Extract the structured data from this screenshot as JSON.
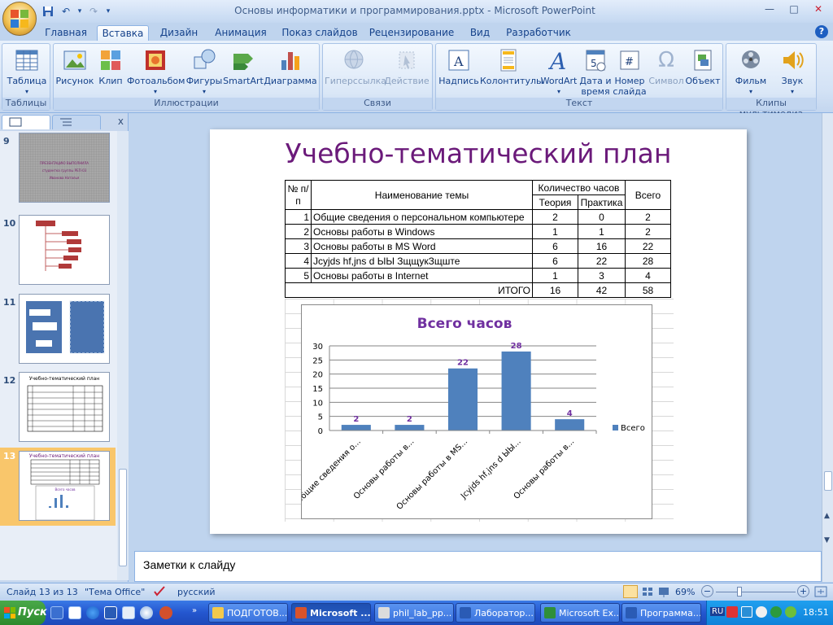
{
  "window": {
    "title": "Основы информатики и программирования.pptx - Microsoft PowerPoint",
    "minimize": "—",
    "maximize": "□",
    "close": "✕"
  },
  "qat": {
    "save": "💾",
    "undo": "↶",
    "redo": "↷",
    "customize": "▾"
  },
  "tabs": [
    "Главная",
    "Вставка",
    "Дизайн",
    "Анимация",
    "Показ слайдов",
    "Рецензирование",
    "Вид",
    "Разработчик"
  ],
  "active_tab": "Вставка",
  "help": "?",
  "ribbon": {
    "groups": {
      "tables": "Таблицы",
      "illustrations": "Иллюстрации",
      "links": "Связи",
      "text": "Текст",
      "media": "Клипы мультимедиа"
    },
    "buttons": {
      "table": "Таблица",
      "picture": "Рисунок",
      "clip": "Клип",
      "photoalbum": "Фотоальбом",
      "shapes": "Фигуры",
      "smartart": "SmartArt",
      "chart": "Диаграмма",
      "hyperlink": "Гиперссылка",
      "action": "Действие",
      "textbox": "Надпись",
      "header_footer": "Колонтитулы",
      "wordart": "WordArt",
      "datetime_1": "Дата и",
      "datetime_2": "время",
      "slidenum_1": "Номер",
      "slidenum_2": "слайда",
      "symbol": "Символ",
      "object": "Объект",
      "movie": "Фильм",
      "sound": "Звук"
    },
    "colors": {
      "chart_bar_blue": "#4f81bd",
      "chart_bar_red": "#c0504d",
      "chart_bar_green": "#9bbb59"
    }
  },
  "slides_panel": {
    "close": "x",
    "items": [
      {
        "num": "9",
        "lines": [
          "ПРЕЗЕНТАЦИЮ ВЫПОЛНИЛА",
          "студентка группы РЕП-03",
          "Иванова Наталья"
        ]
      },
      {
        "num": "10"
      },
      {
        "num": "11"
      },
      {
        "num": "12",
        "title": "Учебно-тематический план"
      },
      {
        "num": "13",
        "title": "Учебно-тематический план",
        "chart_title": "Всего часов"
      }
    ]
  },
  "slide": {
    "title": "Учебно-тематический план",
    "table": {
      "h_num": "№ п/п",
      "h_name": "Наименование темы",
      "h_hours": "Количество часов",
      "h_theory": "Теория",
      "h_practice": "Практика",
      "h_total": "Всего",
      "rows": [
        {
          "n": "1",
          "name": "Общие сведения о персональном компьютере",
          "theory": "2",
          "practice": "0",
          "total": "2"
        },
        {
          "n": "2",
          "name": "Основы работы в Windows",
          "theory": "1",
          "practice": "1",
          "total": "2"
        },
        {
          "n": "3",
          "name": "Основы работы в MS Word",
          "theory": "6",
          "practice": "16",
          "total": "22"
        },
        {
          "n": "4",
          "name": "Jcyjds hf,jns d ЫЫ ЗщщукЗщште",
          "theory": "6",
          "practice": "22",
          "total": "28"
        },
        {
          "n": "5",
          "name": "Основы работы в Internet",
          "theory": "1",
          "practice": "3",
          "total": "4"
        }
      ],
      "itogo_label": "ИТОГО",
      "itogo": {
        "theory": "16",
        "practice": "42",
        "total": "58"
      }
    }
  },
  "chart_data": {
    "type": "bar",
    "title": "Всего часов",
    "categories": [
      "Общие сведения о...",
      "Основы работы в...",
      "Основы работы в MS...",
      "Jcyjds hf,jns d ЫЫ...",
      "Основы работы в..."
    ],
    "series": [
      {
        "name": "Всего",
        "values": [
          2,
          2,
          22,
          28,
          4
        ]
      }
    ],
    "ylim": [
      0,
      30
    ],
    "yticks": [
      0,
      5,
      10,
      15,
      20,
      25,
      30
    ],
    "grid": true,
    "legend": "right",
    "bar_color": "#4f81bd",
    "label_color": "#7030a0",
    "title_color": "#7030a0"
  },
  "notes": {
    "placeholder": "Заметки к слайду"
  },
  "status": {
    "slide": "Слайд 13 из 13",
    "theme": "\"Тема Office\"",
    "lang": "русский",
    "zoom": "69%",
    "zoom_minus": "−",
    "zoom_plus": "+"
  },
  "taskbar": {
    "start": "Пуск",
    "tasks": [
      {
        "label": "ПОДГОТОВ...",
        "color": "#f3c94b"
      },
      {
        "label": "Microsoft ...",
        "color": "#d9532c",
        "active": true
      },
      {
        "label": "phil_lab_pp...",
        "color": "#dcdcdc"
      },
      {
        "label": "Лаборатор...",
        "color": "#2a5bb5"
      },
      {
        "label": "Microsoft Ex...",
        "color": "#2f8f3a"
      },
      {
        "label": "Программа...",
        "color": "#2a5bb5"
      }
    ],
    "lang": "RU",
    "clock": "18:51"
  }
}
